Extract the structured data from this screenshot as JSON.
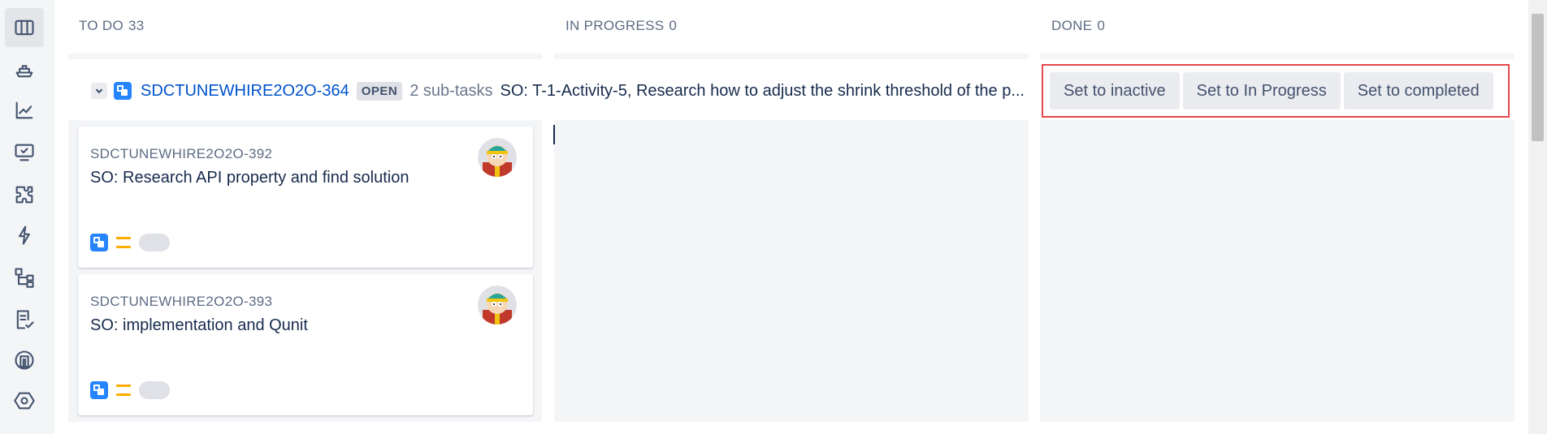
{
  "nav": {
    "items": [
      {
        "name": "board-icon",
        "active": true
      },
      {
        "name": "ship-icon"
      },
      {
        "name": "reports-icon"
      },
      {
        "name": "monitor-check-icon"
      },
      {
        "name": "puzzle-icon"
      },
      {
        "name": "lightning-icon"
      },
      {
        "name": "hierarchy-icon"
      },
      {
        "name": "checklist-icon"
      },
      {
        "name": "building-icon"
      },
      {
        "name": "hexagon-icon"
      }
    ]
  },
  "columns": [
    {
      "title": "TO DO",
      "count": "33"
    },
    {
      "title": "IN PROGRESS",
      "count": "0"
    },
    {
      "title": "DONE",
      "count": "0"
    }
  ],
  "swimlane": {
    "key": "SDCTUNEWHIRE2O2O-364",
    "status": "OPEN",
    "subtasks": "2 sub-tasks",
    "summary": "SO: T-1-Activity-5, Research how to adjust the shrink threshold of the p...",
    "actions": [
      "Set to inactive",
      "Set to In Progress",
      "Set to completed"
    ]
  },
  "cards": [
    {
      "key": "SDCTUNEWHIRE2O2O-392",
      "summary": "SO: Research API property and find solution",
      "type_icon": "subtask-icon",
      "priority_icon": "priority-medium-icon"
    },
    {
      "key": "SDCTUNEWHIRE2O2O-393",
      "summary": "SO: implementation and Qunit",
      "type_icon": "subtask-icon",
      "priority_icon": "priority-medium-icon"
    }
  ],
  "colors": {
    "accent": "#0052cc",
    "highlight_border": "#e5484d",
    "column_bg": "#f4f5f7",
    "priority": "#ffab00",
    "subtask": "#2684ff"
  }
}
